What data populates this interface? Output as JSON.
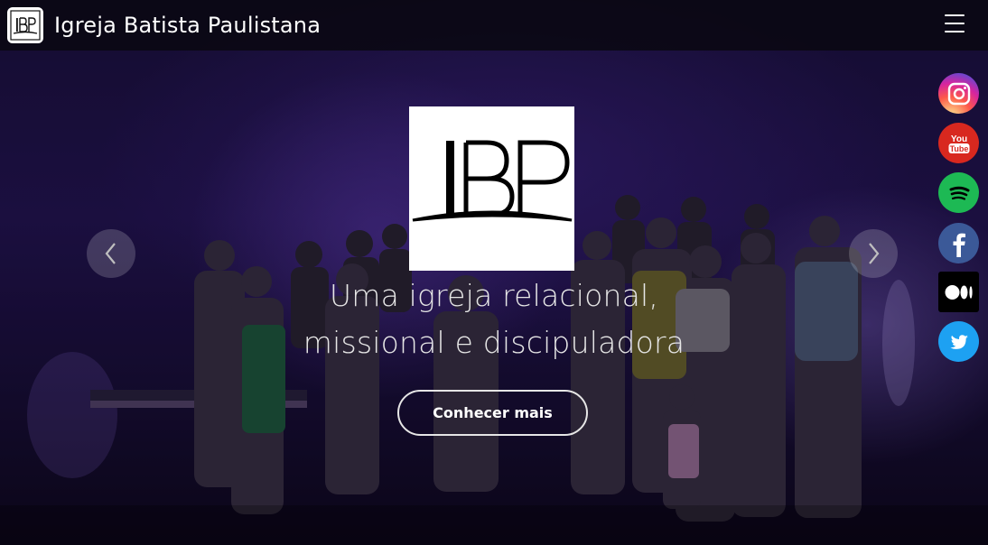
{
  "navbar": {
    "brand": "Igreja Batista Paulistana",
    "logo_alt": "IBP",
    "menu_icon": "hamburger-icon"
  },
  "hero": {
    "logo_text": "IBP",
    "tagline_line1": "Uma igreja relacional,",
    "tagline_line2": "missional e discipuladora",
    "cta_label": "Conhecer mais",
    "prev_icon": "chevron-left-icon",
    "next_icon": "chevron-right-icon"
  },
  "social": [
    {
      "name": "instagram",
      "icon": "instagram-icon",
      "color": "#d6249f"
    },
    {
      "name": "youtube",
      "icon": "youtube-icon",
      "color": "#d8281f",
      "label_top": "You",
      "label_bottom": "Tube"
    },
    {
      "name": "spotify",
      "icon": "spotify-icon",
      "color": "#1db954"
    },
    {
      "name": "facebook",
      "icon": "facebook-icon",
      "color": "#3b5998"
    },
    {
      "name": "medium",
      "icon": "medium-icon",
      "color": "#000000"
    },
    {
      "name": "twitter",
      "icon": "twitter-icon",
      "color": "#1da1f2"
    }
  ]
}
